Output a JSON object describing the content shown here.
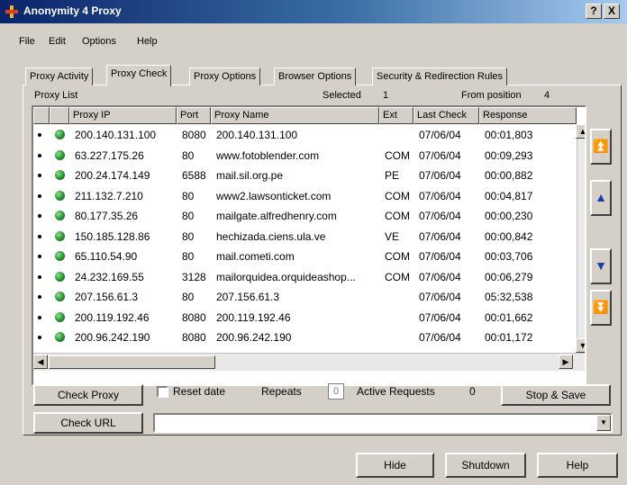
{
  "window": {
    "title": "Anonymity 4 Proxy",
    "help_btn": "?",
    "close_btn": "X"
  },
  "menu": [
    "File",
    "Edit",
    "Options",
    "Help"
  ],
  "tabs": [
    "Proxy Activity",
    "Proxy Check",
    "Proxy Options",
    "Browser Options",
    "Security & Redirection Rules"
  ],
  "list_header": {
    "title": "Proxy List",
    "selected_label": "Selected",
    "selected_value": "1",
    "from_position_label": "From position",
    "from_position_value": "4"
  },
  "columns": [
    "",
    "",
    "Proxy IP",
    "Port",
    "Proxy Name",
    "Ext",
    "Last Check",
    "Response"
  ],
  "rows": [
    {
      "ip": "200.140.131.100",
      "port": "8080",
      "name": "200.140.131.100",
      "ext": "",
      "check": "07/06/04",
      "resp": "00:01,803"
    },
    {
      "ip": "63.227.175.26",
      "port": "80",
      "name": "www.fotoblender.com",
      "ext": "COM",
      "check": "07/06/04",
      "resp": "00:09,293"
    },
    {
      "ip": "200.24.174.149",
      "port": "6588",
      "name": "mail.sil.org.pe",
      "ext": "PE",
      "check": "07/06/04",
      "resp": "00:00,882"
    },
    {
      "ip": "211.132.7.210",
      "port": "80",
      "name": "www2.lawsonticket.com",
      "ext": "COM",
      "check": "07/06/04",
      "resp": "00:04,817"
    },
    {
      "ip": "80.177.35.26",
      "port": "80",
      "name": "mailgate.alfredhenry.com",
      "ext": "COM",
      "check": "07/06/04",
      "resp": "00:00,230"
    },
    {
      "ip": "150.185.128.86",
      "port": "80",
      "name": "hechizada.ciens.ula.ve",
      "ext": "VE",
      "check": "07/06/04",
      "resp": "00:00,842"
    },
    {
      "ip": "65.110.54.90",
      "port": "80",
      "name": "mail.cometi.com",
      "ext": "COM",
      "check": "07/06/04",
      "resp": "00:03,706"
    },
    {
      "ip": "24.232.169.55",
      "port": "3128",
      "name": "mailorquidea.orquideashop...",
      "ext": "COM",
      "check": "07/06/04",
      "resp": "00:06,279"
    },
    {
      "ip": "207.156.61.3",
      "port": "80",
      "name": "207.156.61.3",
      "ext": "",
      "check": "07/06/04",
      "resp": "05:32,538"
    },
    {
      "ip": "200.119.192.46",
      "port": "8080",
      "name": "200.119.192.46",
      "ext": "",
      "check": "07/06/04",
      "resp": "00:01,662"
    },
    {
      "ip": "200.96.242.190",
      "port": "8080",
      "name": "200.96.242.190",
      "ext": "",
      "check": "07/06/04",
      "resp": "00:01,172"
    }
  ],
  "controls": {
    "check_proxy": "Check Proxy",
    "reset_date": "Reset date",
    "repeats_label": "Repeats",
    "repeats_value": "0",
    "active_requests_label": "Active Requests",
    "active_requests_value": "0",
    "stop_save": "Stop & Save",
    "check_url": "Check URL"
  },
  "footer": {
    "hide": "Hide",
    "shutdown": "Shutdown",
    "help": "Help"
  },
  "colors": {
    "status_ok": "#1f8a2a",
    "titlebar": "#0a246a",
    "nav_arrow": "#1b3fa6"
  }
}
